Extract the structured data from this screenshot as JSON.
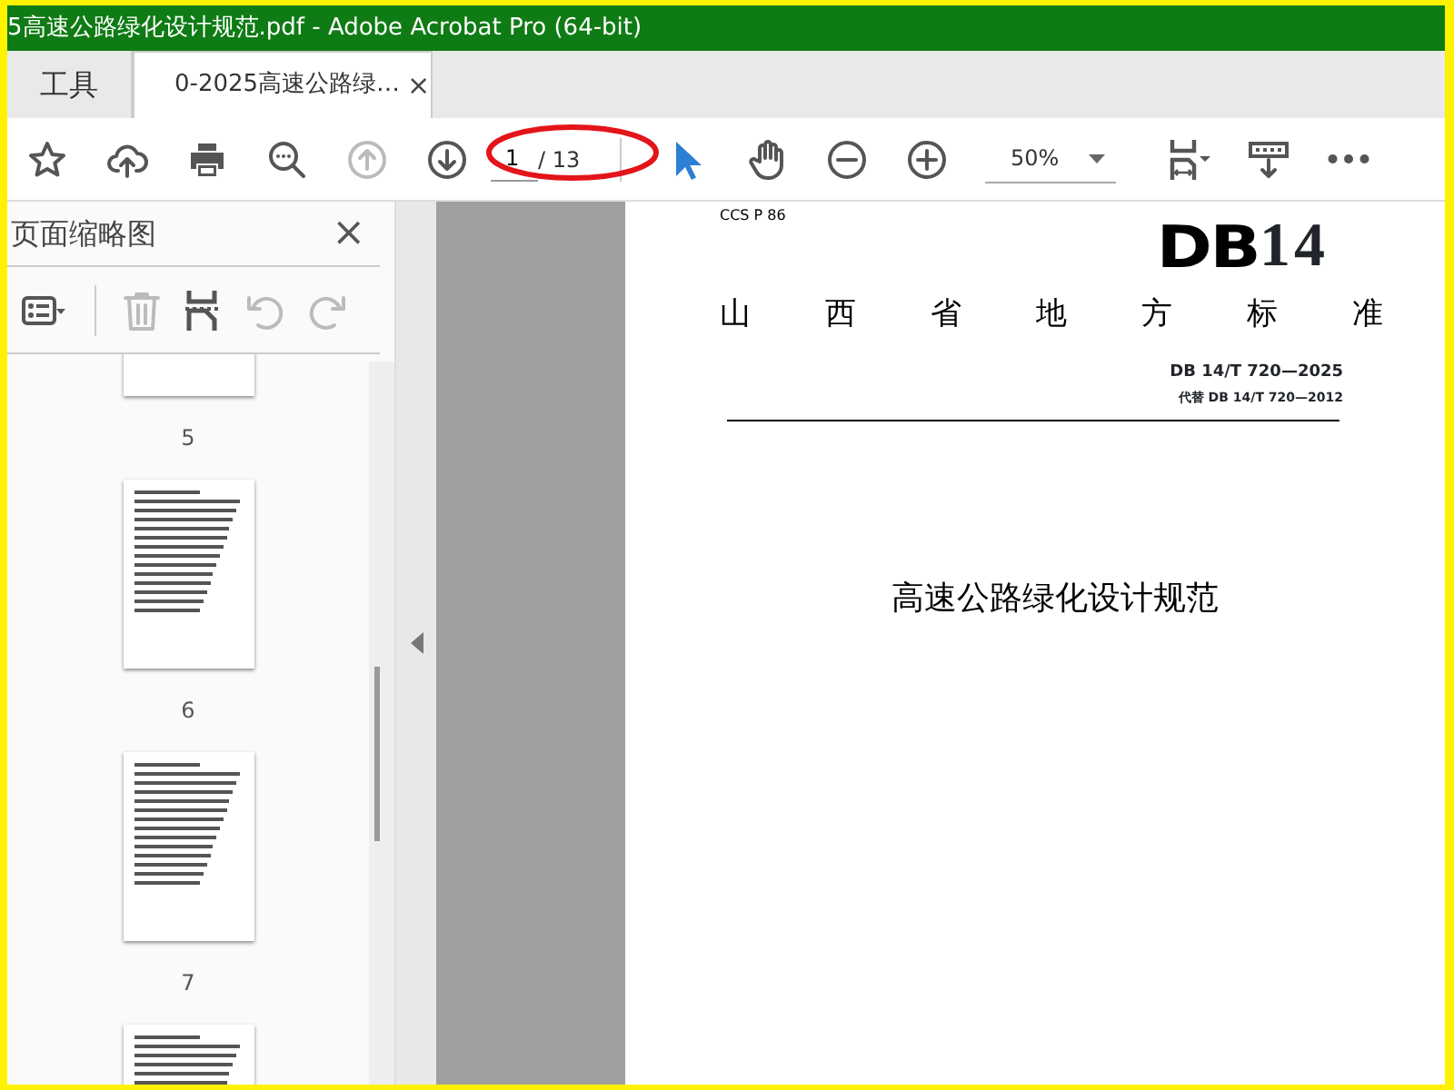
{
  "window": {
    "title": "5高速公路绿化设计规范.pdf - Adobe Acrobat Pro (64-bit)"
  },
  "tabs": [
    {
      "label": "工具",
      "selected": false
    },
    {
      "label": "0-2025高速公路绿…",
      "selected": true,
      "close": "×"
    }
  ],
  "toolbar": [
    {
      "kind": "star",
      "disabled": false
    },
    {
      "kind": "upload",
      "disabled": false
    },
    {
      "kind": "print",
      "disabled": false
    },
    {
      "kind": "zoomsearch",
      "disabled": false
    },
    {
      "kind": "prev",
      "disabled": true
    },
    {
      "kind": "next",
      "disabled": false
    },
    {
      "kind": "pagefield",
      "value": "1",
      "total": "/ 13"
    },
    {
      "kind": "select",
      "selected": true
    },
    {
      "kind": "hand",
      "disabled": false
    },
    {
      "kind": "zoomout",
      "disabled": false
    },
    {
      "kind": "zoomin",
      "disabled": false
    },
    {
      "kind": "zoomfield",
      "value": "50%"
    },
    {
      "kind": "pagedisplay",
      "disabled": false
    },
    {
      "kind": "scrollmode",
      "disabled": false
    },
    {
      "kind": "more",
      "disabled": false
    }
  ],
  "sidebar": {
    "title": "页面缩略图",
    "close": "×",
    "tools": [
      {
        "kind": "options",
        "disabled": false
      },
      {
        "kind": "delete",
        "disabled": true
      },
      {
        "kind": "insert",
        "disabled": false
      },
      {
        "kind": "rotateccw",
        "disabled": true
      },
      {
        "kind": "rotatecw",
        "disabled": true
      }
    ],
    "thumbnails": [
      {
        "label": "5"
      },
      {
        "label": "6"
      },
      {
        "label": "7"
      }
    ]
  },
  "document": {
    "ccs": "CCS  P 86",
    "logo_mark": "DB",
    "logo_number": "14",
    "heading": "山西省地方标准",
    "code": "DB 14/T  720—2025",
    "replaces": "代替  DB 14/T  720—2012",
    "title": "高速公路绿化设计规范"
  }
}
